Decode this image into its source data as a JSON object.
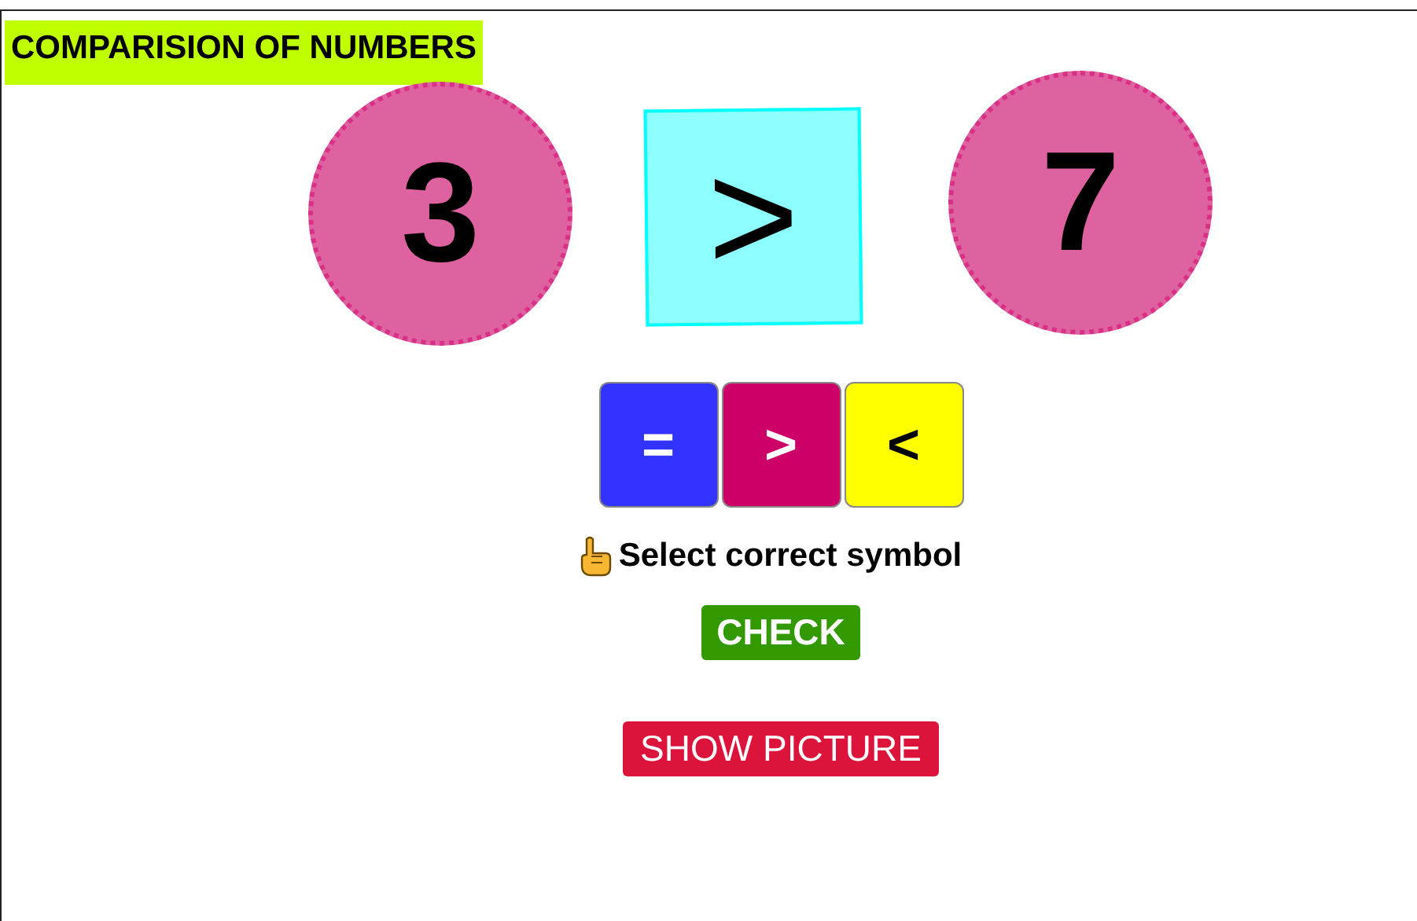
{
  "title": "COMPARISION OF NUMBERS",
  "left_number": "3",
  "answer_symbol": ">",
  "right_number": "7",
  "choices": [
    {
      "label": "=",
      "color": "#3333ff"
    },
    {
      "label": ">",
      "color": "#cc0066"
    },
    {
      "label": "<",
      "color": "#ffff00"
    }
  ],
  "instruction": "Select correct symbol",
  "buttons": [
    {
      "label": "CHECK",
      "kind": "check"
    },
    {
      "label": "SHOW PICTURE",
      "kind": "picture"
    }
  ]
}
